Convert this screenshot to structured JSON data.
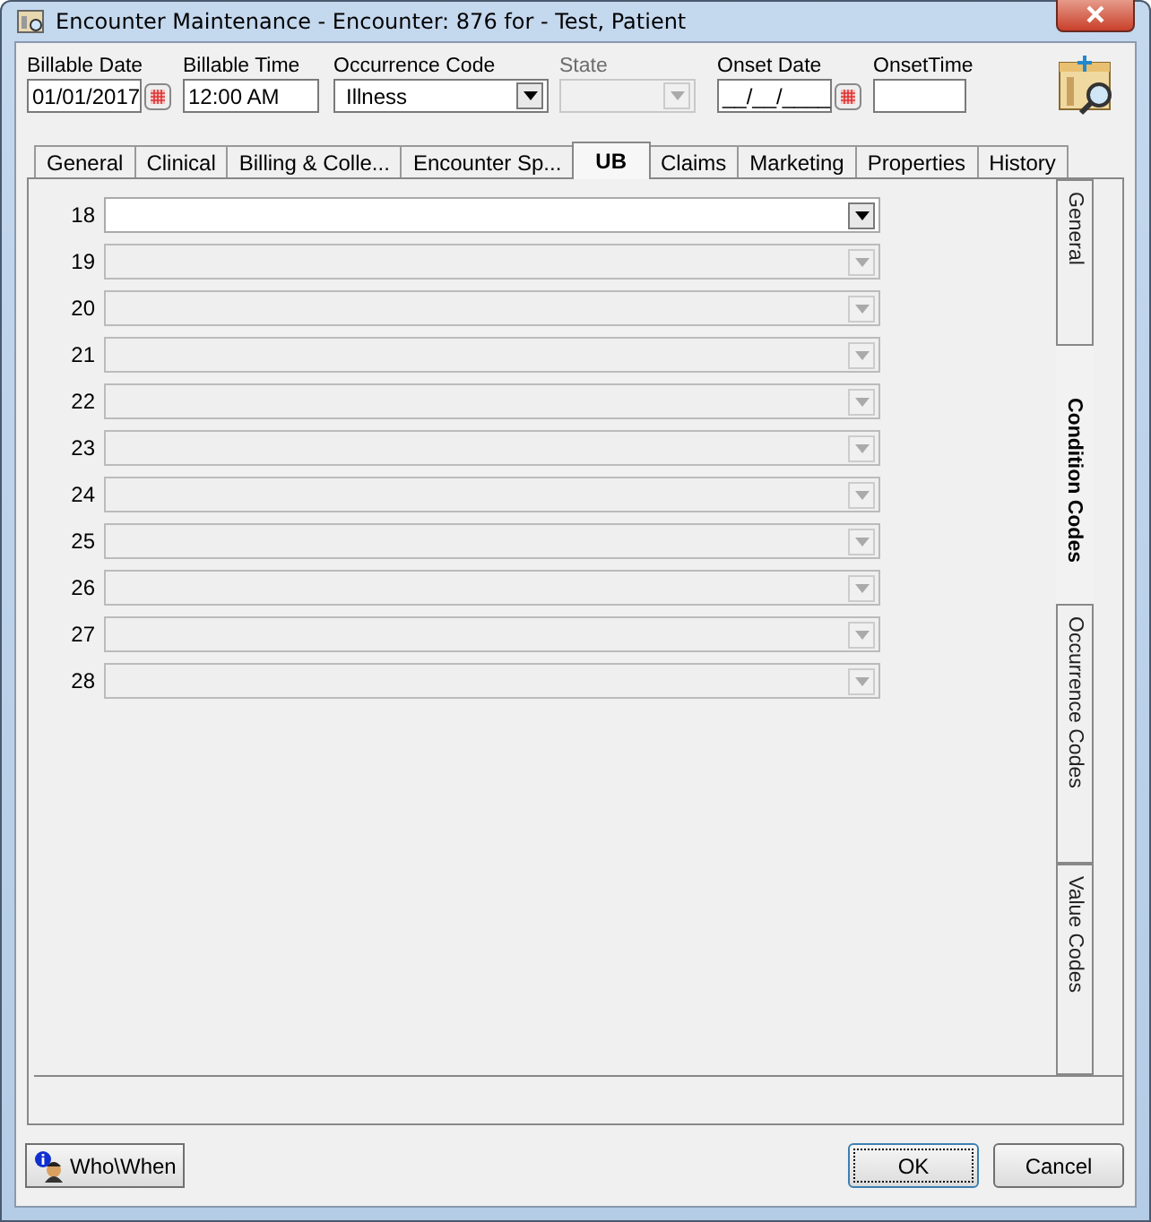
{
  "window": {
    "title": "Encounter Maintenance - Encounter: 876 for - Test, Patient"
  },
  "header_fields": [
    {
      "label": "Billable Date",
      "value": "01/01/2017",
      "kind": "date",
      "disabled": false
    },
    {
      "label": "Billable Time",
      "value": "12:00 AM",
      "kind": "text",
      "disabled": false
    },
    {
      "label": "Occurrence Code",
      "value": "Illness",
      "kind": "dropdown",
      "disabled": false
    },
    {
      "label": "State",
      "kind": "dropdown",
      "disabled": true
    },
    {
      "label": "Onset Date",
      "value": "__/__/____",
      "kind": "date",
      "disabled": false
    },
    {
      "label": "OnsetTime",
      "kind": "text",
      "disabled": false
    }
  ],
  "tabs": [
    {
      "label": "General",
      "selected": false
    },
    {
      "label": "Clinical",
      "selected": false
    },
    {
      "label": "Billing & Colle...",
      "selected": false
    },
    {
      "label": "Encounter  Sp...",
      "selected": false
    },
    {
      "label": "UB",
      "selected": true
    },
    {
      "label": "Claims",
      "selected": false
    },
    {
      "label": "Marketing",
      "selected": false
    },
    {
      "label": "Properties",
      "selected": false
    },
    {
      "label": "History",
      "selected": false
    }
  ],
  "condition_rows": [
    {
      "number": "18",
      "disabled": false
    },
    {
      "number": "19",
      "disabled": true
    },
    {
      "number": "20",
      "disabled": true
    },
    {
      "number": "21",
      "disabled": true
    },
    {
      "number": "22",
      "disabled": true
    },
    {
      "number": "23",
      "disabled": true
    },
    {
      "number": "24",
      "disabled": true
    },
    {
      "number": "25",
      "disabled": true
    },
    {
      "number": "26",
      "disabled": true
    },
    {
      "number": "27",
      "disabled": true
    },
    {
      "number": "28",
      "disabled": true
    }
  ],
  "side_tabs": [
    {
      "label": "General",
      "selected": false
    },
    {
      "label": "Condition Codes",
      "selected": true
    },
    {
      "label": "Occurrence Codes",
      "selected": false
    },
    {
      "label": "Value Codes",
      "selected": false
    }
  ],
  "buttons": {
    "who_when": "Who\\When",
    "ok": "OK",
    "cancel": "Cancel"
  }
}
